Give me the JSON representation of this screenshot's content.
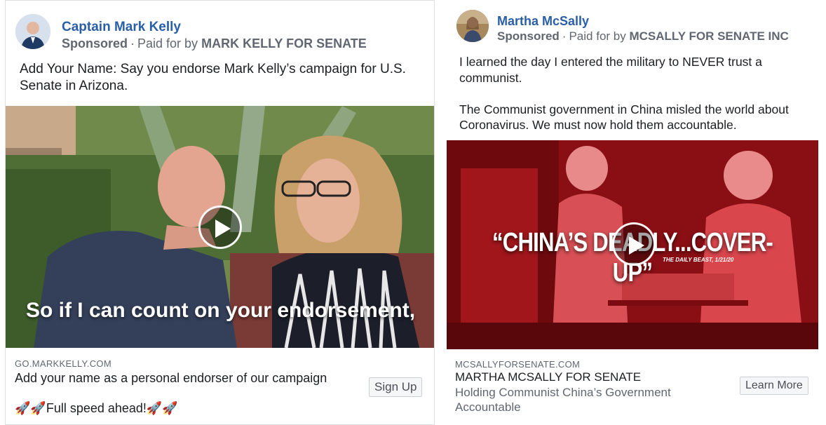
{
  "left_ad": {
    "page_name": "Captain Mark Kelly",
    "sponsored": "Sponsored",
    "paid_for_prefix": "Paid for by",
    "paid_for_by": "MARK KELLY FOR SENATE",
    "post_text": "Add Your Name: Say you endorse Mark Kelly’s campaign for U.S. Senate in Arizona.",
    "video_caption": "So if I can count on your endorsement,",
    "link_domain": "GO.MARKKELLY.COM",
    "link_title": "Add your name as a personal endorser of our campaign",
    "link_description": "🚀🚀Full speed ahead!🚀🚀",
    "cta_label": "Sign Up"
  },
  "right_ad": {
    "page_name": "Martha McSally",
    "sponsored": "Sponsored",
    "paid_for_prefix": "Paid for by",
    "paid_for_by": "MCSALLY FOR SENATE INC",
    "post_text": "I learned the day I entered the military to NEVER trust a communist.\n\nThe Communist government in China misled the world about Coronavirus. We must now hold them accountable.",
    "video_headline": "“CHINA’S DEADLY...COVER-UP”",
    "video_source": "THE DAILY BEAST, 1/21/20",
    "link_domain": "MCSALLYFORSENATE.COM",
    "link_title": "MARTHA MCSALLY FOR SENATE",
    "link_description": "Holding Communist China’s Government Accountable",
    "cta_label": "Learn More"
  },
  "icons": [
    "play-icon",
    "avatar"
  ]
}
